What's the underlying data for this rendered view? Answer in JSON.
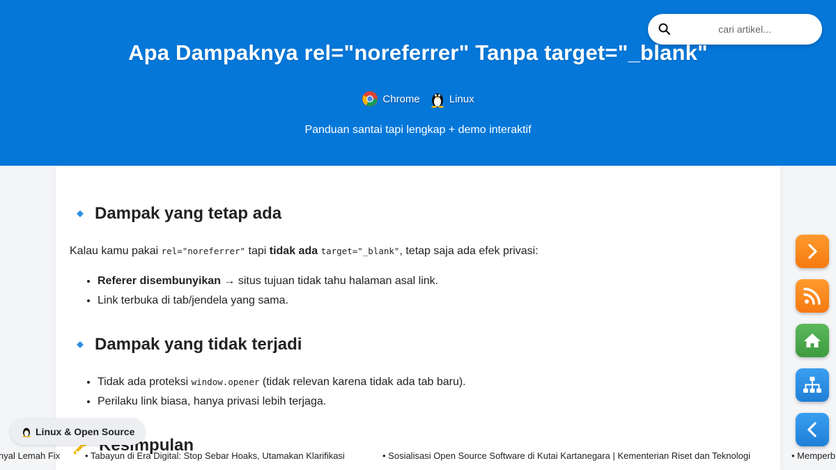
{
  "header": {
    "title": "Apa Dampaknya rel=\"noreferrer\" Tanpa target=\"_blank\"",
    "tags": [
      "Chrome",
      "Linux"
    ],
    "tagline": "Panduan santai tapi lengkap + demo interaktif"
  },
  "search": {
    "placeholder": "cari artikel..."
  },
  "sections": {
    "s1": {
      "heading": "Dampak yang tetap ada",
      "lead": {
        "a": "Kalau kamu pakai ",
        "code1": "rel=\"noreferrer\"",
        "b": " tapi ",
        "strong": "tidak ada",
        "code2": "target=\"_blank\"",
        "c": ", tetap saja ada efek privasi:"
      },
      "items": [
        {
          "strong": "Referer disembunyikan",
          "text": " → situs tujuan tidak tahu halaman asal link."
        },
        {
          "text": "Link terbuka di tab/jendela yang sama."
        }
      ]
    },
    "s2": {
      "heading": "Dampak yang tidak terjadi",
      "items": [
        {
          "a": "Tidak ada proteksi ",
          "code": "window.opener",
          "b": " (tidak relevan karena tidak ada tab baru)."
        },
        {
          "text": "Perilaku link biasa, hanya privasi lebih terjaga."
        }
      ]
    },
    "s3": {
      "icon": "key-icon",
      "heading": "Kesimpulan"
    }
  },
  "category_pill": {
    "label": "Linux & Open Source",
    "icon": "penguin-icon"
  },
  "ticker": [
    "nyal Lemah Fix",
    "• Tabayun di Era Digital: Stop Sebar Hoaks, Utamakan Klarifikasi",
    "• Sosialisasi Open Source Software di Kutai Kartanegara | Kementerian Riset dan Teknologi",
    "• Memperb"
  ],
  "side_buttons": [
    "next-icon",
    "rss-icon",
    "home-icon",
    "sitemap-icon",
    "back-icon"
  ],
  "colors": {
    "header_bg": "#0477d9",
    "orange": "#f7891f",
    "green": "#4cae4c",
    "blue": "#2b8fe6"
  }
}
